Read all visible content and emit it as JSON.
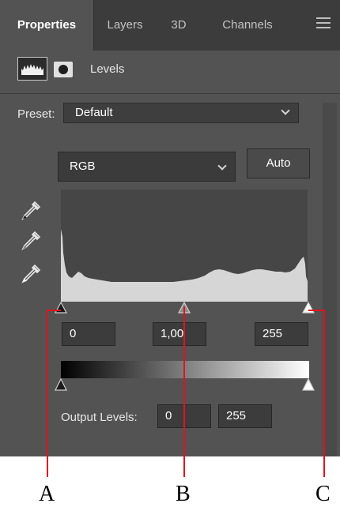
{
  "tabs": [
    {
      "label": "Properties",
      "active": true
    },
    {
      "label": "Layers",
      "active": false
    },
    {
      "label": "3D",
      "active": false
    },
    {
      "label": "Channels",
      "active": false
    }
  ],
  "menu_icon": "hamburger-menu-icon",
  "header": {
    "title": "Levels",
    "icons": [
      "levels-histogram-icon",
      "layer-mask-icon"
    ]
  },
  "preset": {
    "label": "Preset:",
    "value": "Default"
  },
  "channel": {
    "value": "RGB"
  },
  "auto_label": "Auto",
  "eyedroppers": [
    "black-point-eyedropper-icon",
    "gray-point-eyedropper-icon",
    "white-point-eyedropper-icon"
  ],
  "input_levels": {
    "black": "0",
    "gamma": "1,00",
    "white": "255"
  },
  "output_levels": {
    "label": "Output Levels:",
    "black": "0",
    "white": "255"
  },
  "annotations": [
    {
      "letter": "A",
      "target": "black-input-slider"
    },
    {
      "letter": "B",
      "target": "midtone-input-slider"
    },
    {
      "letter": "C",
      "target": "white-input-slider"
    }
  ],
  "colors": {
    "panel_bg": "#535353",
    "tab_bar_bg": "#3c3c3c",
    "field_bg": "#3c3c3c",
    "histogram_bg": "#464646",
    "histogram_fill": "#d6d6d6",
    "callout_line": "#e0141e"
  }
}
